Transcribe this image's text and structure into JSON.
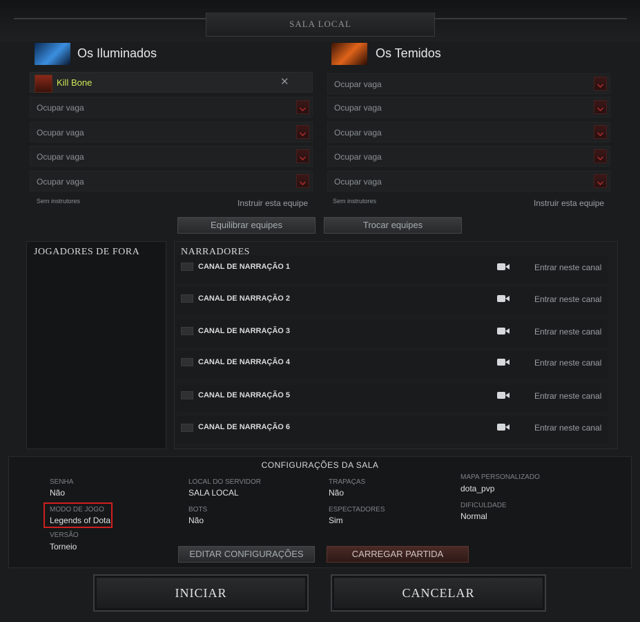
{
  "window": {
    "title": "SALA LOCAL"
  },
  "teams": {
    "radiant": {
      "name": "Os Iluminados",
      "player": {
        "name": "Kill Bone",
        "remove_icon": "close-icon"
      },
      "open_slots": [
        "Ocupar vaga",
        "Ocupar vaga",
        "Ocupar vaga",
        "Ocupar vaga"
      ],
      "coaches": "Sem instrutores",
      "coach_link": "Instruir esta equipe"
    },
    "dire": {
      "name": "Os Temidos",
      "open_slots": [
        "Ocupar vaga",
        "Ocupar vaga",
        "Ocupar vaga",
        "Ocupar vaga",
        "Ocupar vaga"
      ],
      "coaches": "Sem instrutores",
      "coach_link": "Instruir esta equipe"
    }
  },
  "team_actions": {
    "balance": "Equilibrar equipes",
    "swap": "Trocar equipes"
  },
  "unassigned": {
    "title": "JOGADORES DE FORA"
  },
  "broadcasters": {
    "title": "NARRADORES",
    "channels": [
      {
        "label": "CANAL DE NARRAÇÃO 1",
        "join": "Entrar neste canal"
      },
      {
        "label": "CANAL DE NARRAÇÃO 2",
        "join": "Entrar neste canal"
      },
      {
        "label": "CANAL DE NARRAÇÃO 3",
        "join": "Entrar neste canal"
      },
      {
        "label": "CANAL DE NARRAÇÃO 4",
        "join": "Entrar neste canal"
      },
      {
        "label": "CANAL DE NARRAÇÃO 5",
        "join": "Entrar neste canal"
      },
      {
        "label": "CANAL DE NARRAÇÃO 6",
        "join": "Entrar neste canal"
      }
    ]
  },
  "settings": {
    "title": "CONFIGURAÇÕES DA SALA",
    "password": {
      "label": "SENHA",
      "value": "Não"
    },
    "game_mode": {
      "label": "MODO DE JOGO",
      "value": "Legends of Dota"
    },
    "version": {
      "label": "VERSÃO",
      "value": "Torneio"
    },
    "server": {
      "label": "LOCAL DO SERVIDOR",
      "value": "SALA LOCAL"
    },
    "bots": {
      "label": "BOTS",
      "value": "Não"
    },
    "cheats": {
      "label": "TRAPAÇAS",
      "value": "Não"
    },
    "spectators": {
      "label": "ESPECTADORES",
      "value": "Sim"
    },
    "custom_map": {
      "label": "MAPA PERSONALIZADO",
      "value": "dota_pvp"
    },
    "difficulty": {
      "label": "DIFICULDADE",
      "value": "Normal"
    },
    "edit_button": "EDITAR CONFIGURAÇÕES",
    "load_button": "CARREGAR PARTIDA",
    "highlight_color": "#d01f1f"
  },
  "actions": {
    "start": "INICIAR",
    "cancel": "CANCELAR"
  }
}
